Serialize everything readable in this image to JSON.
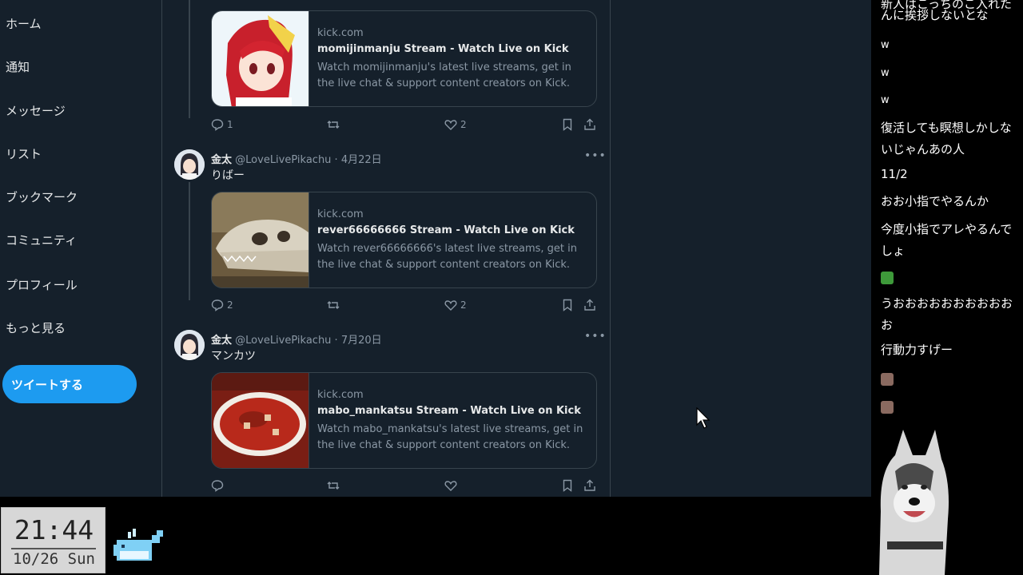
{
  "nav": {
    "items": [
      "ホーム",
      "通知",
      "メッセージ",
      "リスト",
      "ブックマーク",
      "コミュニティ",
      "プロフィール",
      "もっと見る"
    ],
    "tweet_button": "ツイートする"
  },
  "tweets": [
    {
      "card": {
        "domain": "kick.com",
        "title": "momijinmanju Stream - Watch Live on Kick",
        "description": "Watch momijinmanju's latest live streams, get in the live chat & support content creators on Kick. Join the..."
      },
      "actions": {
        "replies": "1",
        "retweets": "",
        "likes": "2"
      }
    },
    {
      "author_name": "金太",
      "handle": "@LoveLivePikachu",
      "date": "4月22日",
      "text": "りばー",
      "card": {
        "domain": "kick.com",
        "title": "rever66666666 Stream - Watch Live on Kick",
        "description": "Watch rever66666666's latest live streams, get in the live chat & support content creators on Kick. Join the..."
      },
      "actions": {
        "replies": "2",
        "retweets": "",
        "likes": "2"
      }
    },
    {
      "author_name": "金太",
      "handle": "@LoveLivePikachu",
      "date": "7月20日",
      "text": "マンカツ",
      "card": {
        "domain": "kick.com",
        "title": "mabo_mankatsu Stream - Watch Live on Kick",
        "description": "Watch mabo_mankatsu's latest live streams, get in the live chat & support content creators on Kick. Join the..."
      },
      "actions": {
        "replies": "",
        "retweets": "",
        "likes": ""
      }
    }
  ],
  "separator": " · ",
  "chat": {
    "messages": [
      "新人はこっちのこ入れたら",
      "んに挨拶しないとな",
      "w",
      "w",
      "w",
      "復活しても瞑想しかしないじゃんあの人",
      "11/2",
      "おお小指でやるんか",
      "今度小指でアレやるんでしょ",
      "うおおおおおおおおおおお",
      "行動力すげー"
    ]
  },
  "clock": {
    "time": "21:44",
    "date": "10/26 Sun"
  },
  "colors": {
    "accent": "#1d9bf0",
    "background": "#15202b",
    "border": "#38444d",
    "muted": "#8b98a5"
  }
}
